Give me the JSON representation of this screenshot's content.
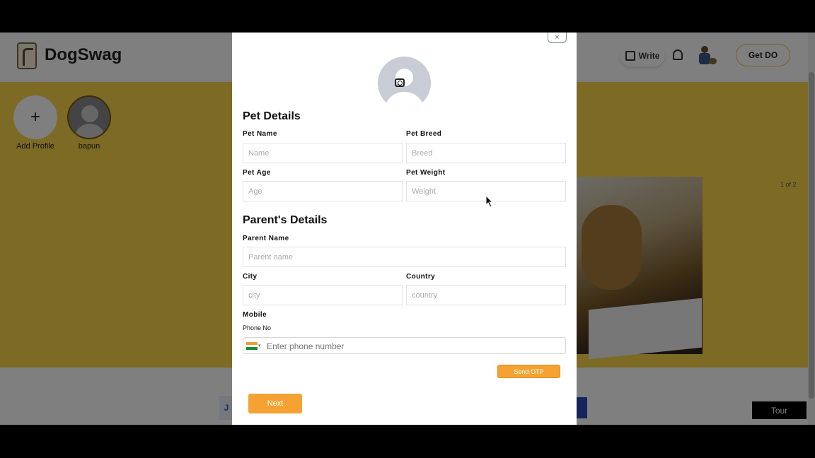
{
  "header": {
    "brand": "DogSwag",
    "write_label": "Write",
    "get_do_label": "Get DO"
  },
  "profiles": {
    "add_profile_symbol": "+",
    "add_profile_label": "Add Profile",
    "profile_name": "bapun"
  },
  "background": {
    "page_counter": "1 of 2",
    "tour_label": "Tour",
    "peek_left_text": "J"
  },
  "modal": {
    "close_symbol": "×",
    "pet_section_title": "Pet Details",
    "pet_name_label": "Pet Name",
    "pet_name_placeholder": "Name",
    "pet_breed_label": "Pet Breed",
    "pet_breed_placeholder": "Breed",
    "pet_age_label": "Pet Age",
    "pet_age_placeholder": "Age",
    "pet_weight_label": "Pet Weight",
    "pet_weight_placeholder": "Weight",
    "parent_section_title": "Parent's Details",
    "parent_name_label": "Parent Name",
    "parent_name_placeholder": "Parent name",
    "city_label": "City",
    "city_placeholder": "city",
    "country_label": "Country",
    "country_placeholder": "country",
    "mobile_label": "Mobile",
    "phone_label": "Phone No",
    "phone_placeholder": "Enter phone number",
    "chevron_symbol": "▾",
    "send_otp_label": "Send OTP",
    "next_label": "Next"
  },
  "colors": {
    "accent_orange": "#f5a233",
    "background_yellow": "#f8d54a"
  },
  "icons": [
    "pen-icon",
    "bell-icon",
    "camera-icon",
    "india-flag-icon",
    "chevron-down-icon",
    "close-icon",
    "cursor-icon"
  ]
}
